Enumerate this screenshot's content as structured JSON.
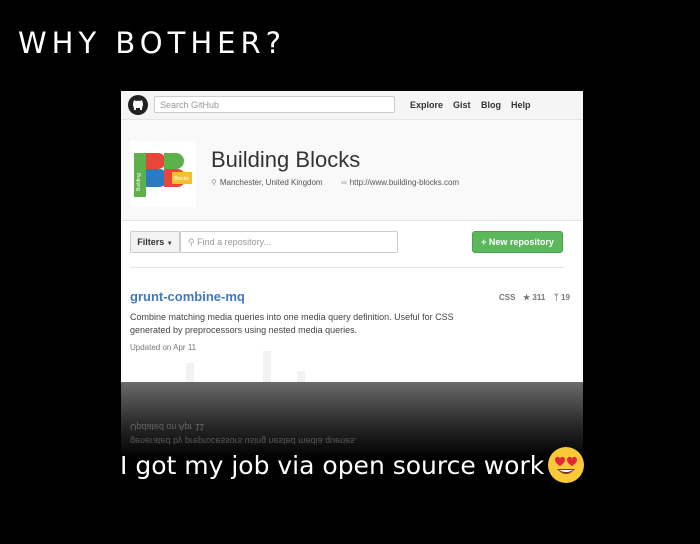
{
  "slide": {
    "title": "WHY BOTHER?",
    "caption": "I got my job via open source work"
  },
  "github": {
    "search_placeholder": "Search GitHub",
    "nav": [
      "Explore",
      "Gist",
      "Blog",
      "Help"
    ]
  },
  "org": {
    "name": "Building Blocks",
    "location": "Manchester, United Kingdom",
    "website": "http://www.building-blocks.com",
    "avatar_side_text": "Building",
    "avatar_badge_text": "Blocks"
  },
  "toolbar": {
    "filters_label": "Filters",
    "repo_search_placeholder": "Find a repository...",
    "new_repo_label": "+ New repository"
  },
  "repo": {
    "name": "grunt-combine-mq",
    "language": "CSS",
    "stars": "311",
    "forks": "19",
    "description": "Combine matching media queries into one media query definition. Useful for CSS generated by preprocessors using nested media queries.",
    "updated": "Updated on Apr 11"
  },
  "reflection": {
    "line1": "Updated on Apr 11",
    "line2": "generated by preprocessors using nested media queries."
  },
  "colors": {
    "link": "#4078c0",
    "button_green": "#5cb85c",
    "brand_red": "#e8463a",
    "brand_blue": "#2c7bc0",
    "brand_green": "#5db14a",
    "brand_yellow": "#f2c12e"
  },
  "icons": {
    "logo": "github-octocat-icon",
    "emoji": "heart-eyes-emoji-icon"
  }
}
